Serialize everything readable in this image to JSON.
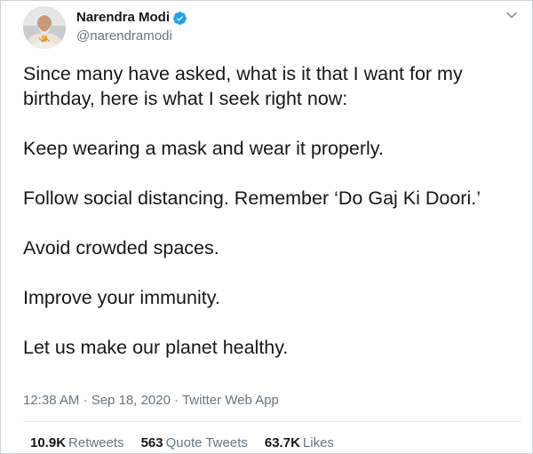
{
  "tweet": {
    "author": {
      "display_name": "Narendra Modi",
      "handle": "@narendramodi",
      "verified": true,
      "avatar_icon": "user-avatar-portrait"
    },
    "paragraphs": [
      "Since many have asked, what is it that I want for my birthday, here is what I seek right now:",
      "Keep wearing a mask and wear it properly.",
      "Follow social distancing. Remember ‘Do Gaj Ki Doori.’",
      "Avoid crowded spaces.",
      "Improve your immunity.",
      "Let us make our planet healthy."
    ],
    "timestamp": "12:38 AM · Sep 18, 2020",
    "source": "Twitter Web App",
    "stats": {
      "retweets_count": "10.9K",
      "retweets_label": "Retweets",
      "quote_count": "563",
      "quote_label": "Quote Tweets",
      "likes_count": "63.7K",
      "likes_label": "Likes"
    }
  },
  "colors": {
    "text_primary": "#14171a",
    "text_secondary": "#657786",
    "verified_blue": "#1da1f2",
    "divider": "#e6ecf0"
  },
  "icons": {
    "verified": "verified-badge-icon",
    "menu": "chevron-down-icon"
  }
}
